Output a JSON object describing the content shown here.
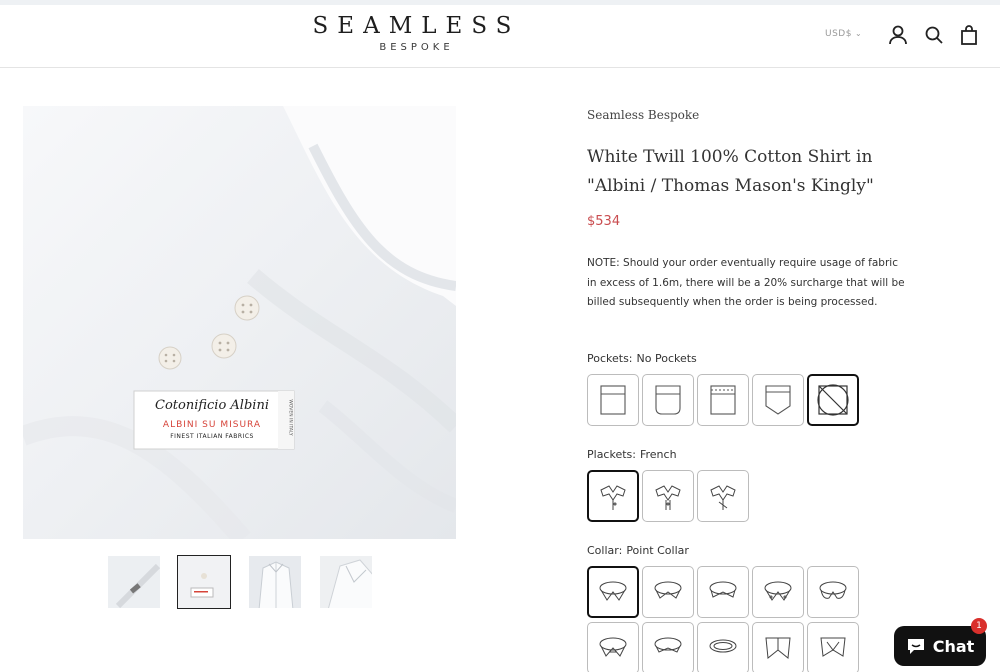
{
  "header": {
    "logo_main": "SEAMLESS",
    "logo_sub": "BESPOKE",
    "currency": "USD$",
    "icons": [
      "account-icon",
      "search-icon",
      "cart-icon"
    ]
  },
  "gallery": {
    "label_brand": "Cotonificio Albini",
    "label_line": "ALBINI SU MISURA",
    "label_fine": "FINEST ITALIAN FABRICS",
    "label_side": "WOVEN IN ITALY",
    "thumbnails": [
      "thumb-1",
      "thumb-2",
      "thumb-3",
      "thumb-4"
    ],
    "active_thumbnail": 2
  },
  "product": {
    "vendor": "Seamless Bespoke",
    "title": "White Twill 100% Cotton Shirt in \"Albini / Thomas Mason's Kingly\"",
    "price": "$534",
    "note": "NOTE: Should your order eventually require usage of fabric in excess of 1.6m, there will be a 20% surcharge that will be billed subsequently when the order is being processed."
  },
  "options": {
    "pockets": {
      "label": "Pockets:",
      "value": "No Pockets",
      "count": 5,
      "selected": 5
    },
    "plackets": {
      "label": "Plackets:",
      "value": "French",
      "count": 3,
      "selected": 1
    },
    "collar": {
      "label": "Collar:",
      "value": "Point Collar",
      "count": 10,
      "selected": 1
    }
  },
  "chat": {
    "label": "Chat",
    "badge": "1"
  },
  "colors": {
    "price": "#c94d50",
    "label_red": "#d6443a",
    "chat_bg": "#111111",
    "badge": "#d9302c"
  }
}
